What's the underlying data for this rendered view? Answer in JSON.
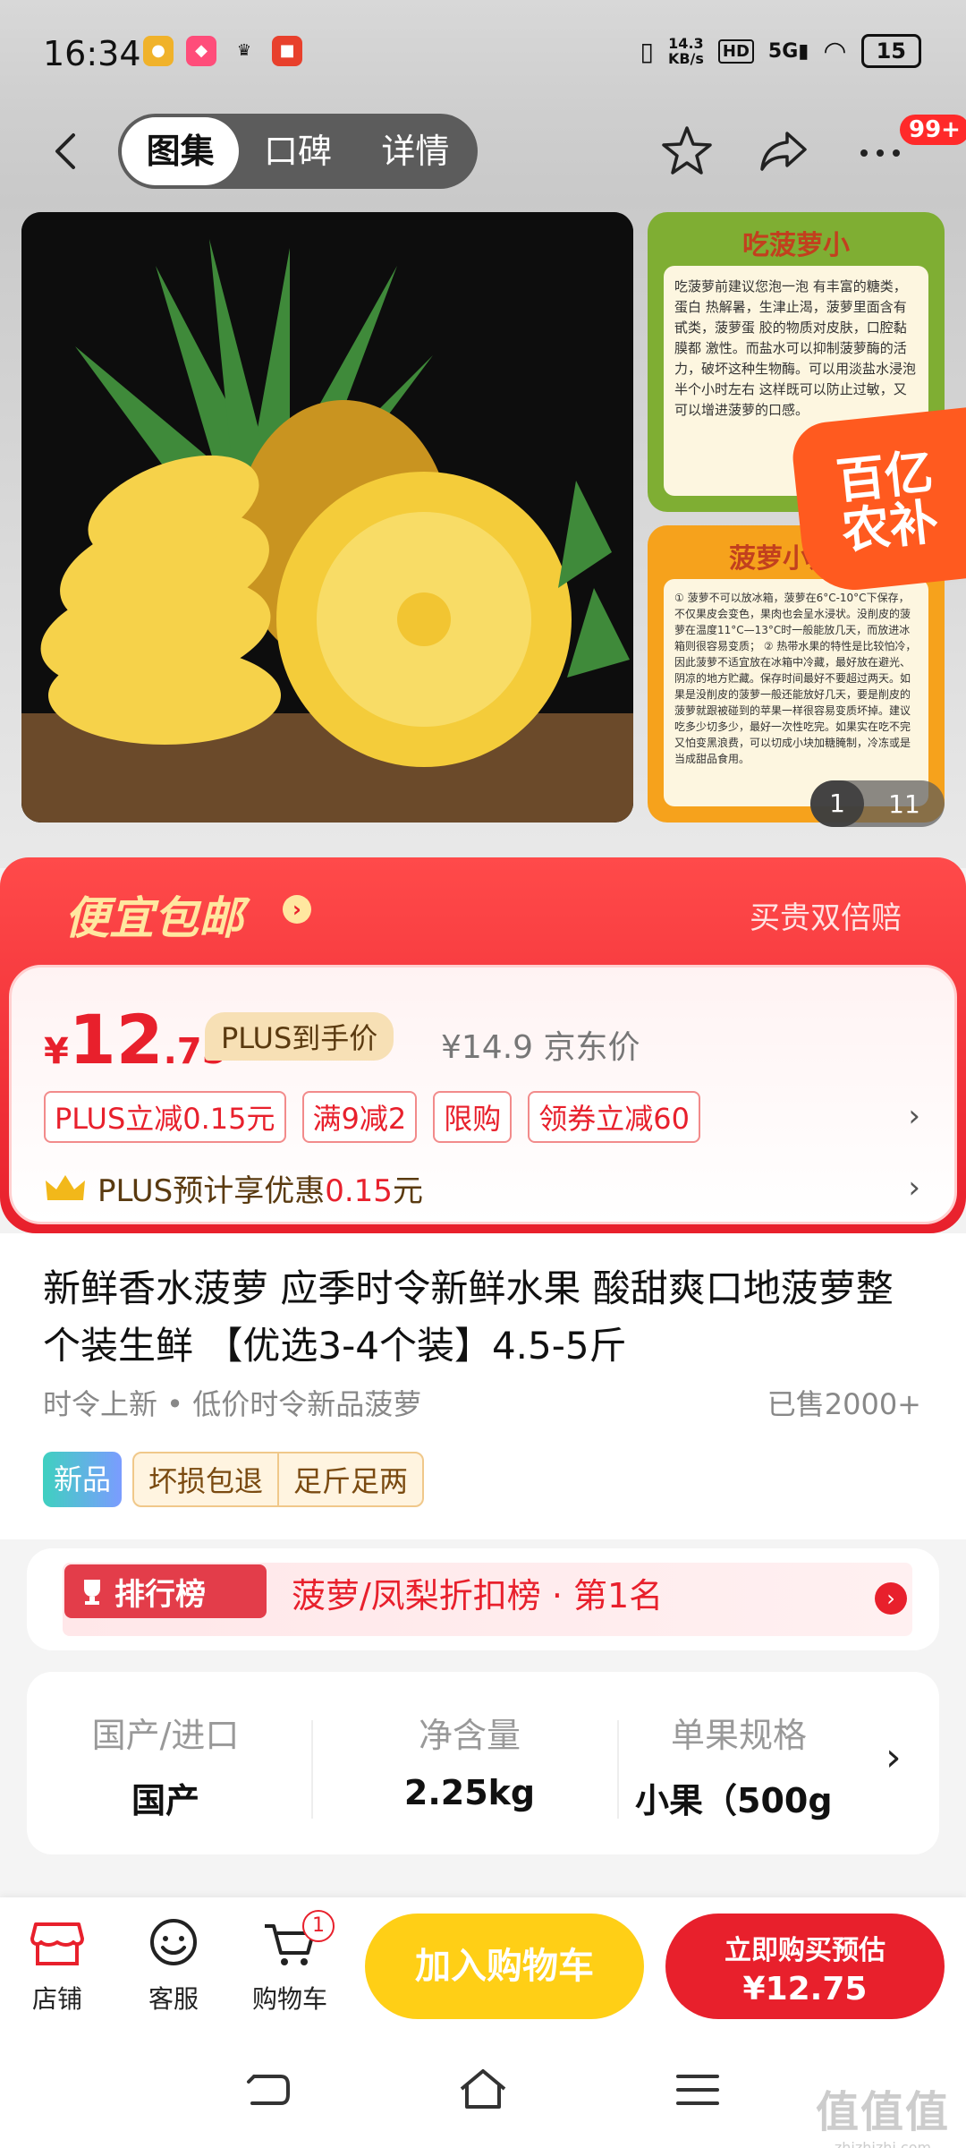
{
  "status": {
    "time": "16:34",
    "net_speed_value": "14.3",
    "net_speed_unit": "KB/s",
    "hd": "HD",
    "signal": "5G",
    "battery": "15"
  },
  "nav": {
    "tabs": [
      {
        "label": "图集",
        "active": true
      },
      {
        "label": "口碑",
        "active": false
      },
      {
        "label": "详情",
        "active": false
      }
    ],
    "more_badge": "99+"
  },
  "gallery": {
    "thumb1_title": "吃菠萝小",
    "thumb1_text": "吃菠萝前建议您泡一泡 有丰富的糖类，蛋白 热解暑，生津止渴，菠萝里面含有甙类，菠萝蛋 胶的物质对皮肤，口腔黏膜都 激性。而盐水可以抑制菠萝酶的活力，破坏这种生物酶。可以用淡盐水浸泡半个小时左右 这样既可以防止过敏，又可以增进菠萝的口感。",
    "thumb2_title": "菠萝小知识",
    "thumb2_text": "① 菠萝不可以放冰箱，菠萝在6°C-10°C下保存，不仅果皮会变色，果肉也会呈水浸状。没削皮的菠萝在温度11°C—13°C时一般能放几天，而放进冰箱则很容易变质； ② 热带水果的特性是比较怕冷，因此菠萝不适宜放在冰箱中冷藏，最好放在避光、阴凉的地方贮藏。保存时间最好不要超过两天。如果是没削皮的菠萝一般还能放好几天，要是削皮的菠萝就跟被碰到的苹果一样很容易变质坏掉。建议吃多少切多少，最好一次性吃完。如果实在吃不完又怕变黑浪费，可以切成小块加糖腌制，冷冻或是当成甜品食用。",
    "sticker_line1": "百亿",
    "sticker_line2": "农补",
    "page_current": "1",
    "page_total": "11"
  },
  "promo": {
    "title": "便宜包邮",
    "right_text": "买贵双倍赔"
  },
  "price": {
    "currency": "¥",
    "integer": "12",
    "decimal": ".75",
    "plus_tag": "PLUS到手价",
    "jd_price": "¥14.9 京东价",
    "chips": [
      "PLUS立减0.15元",
      "满9减2",
      "限购",
      "领券立减60"
    ],
    "plus_prefix": "PLUS预计享优惠",
    "plus_amount": "0.15",
    "plus_suffix": "元"
  },
  "product": {
    "title": "新鲜香水菠萝 应季时令新鲜水果 酸甜爽口地菠萝整个装生鲜 【优选3-4个装】4.5-5斤",
    "subline": "时令上新 • 低价时令新品菠萝",
    "sold": "已售2000+",
    "tag_new": "新品",
    "tag_box": [
      "坏损包退",
      "足斤足两"
    ]
  },
  "rank": {
    "badge": "排行榜",
    "text": "菠萝/凤梨折扣榜 · 第1名"
  },
  "specs": [
    {
      "label": "国产/进口",
      "value": "国产"
    },
    {
      "label": "净含量",
      "value": "2.25kg"
    },
    {
      "label": "单果规格",
      "value": "小果（500g"
    }
  ],
  "bottom": {
    "store": "店铺",
    "service": "客服",
    "cart": "购物车",
    "cart_count": "1",
    "add_cart": "加入购物车",
    "buy_line1": "立即购买预估",
    "buy_line2": "¥12.75"
  },
  "watermark": {
    "big": "值值值",
    "small": "zhizhizhi.com"
  },
  "colors": {
    "accent_red": "#e8202c",
    "cart_yellow": "#ffcf16",
    "plus_gold": "#f7e0b5"
  }
}
